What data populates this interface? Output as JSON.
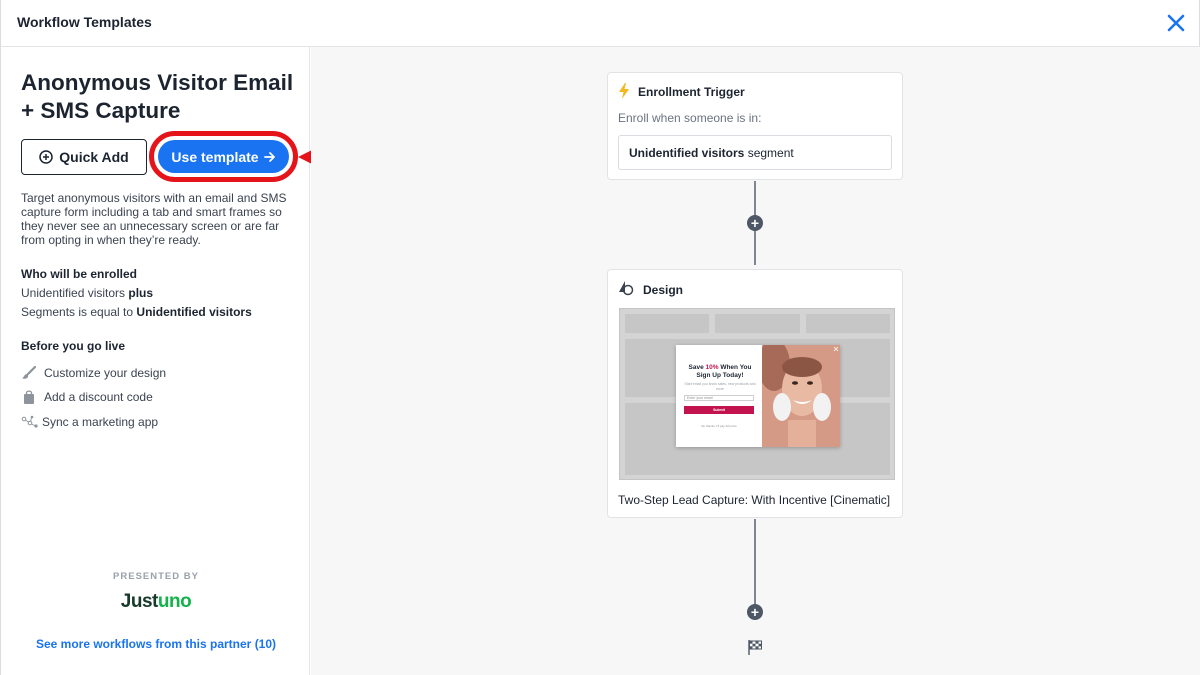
{
  "header": {
    "title": "Workflow Templates",
    "close_icon": "close-x-icon",
    "close_color": "#1a73f0"
  },
  "template": {
    "title": "Anonymous Visitor Email + SMS Capture",
    "quick_add_label": "Quick Add",
    "use_template_label": "Use template",
    "description": "Target anonymous visitors with an email and SMS capture form including a tab and smart frames so they never see an unnecessary screen or are far from opting in when they’re ready.",
    "enrolled": {
      "heading": "Who will be enrolled",
      "line1_text": "Unidentified visitors ",
      "line1_bold": "plus",
      "line2_text": "Segments is equal to ",
      "line2_bold": "Unidentified visitors"
    },
    "before_live": {
      "heading": "Before you go live",
      "items": [
        {
          "label": "Customize your design",
          "icon": "paintbrush-icon"
        },
        {
          "label": "Add a discount code",
          "icon": "shopping-bag-icon"
        },
        {
          "label": "Sync a marketing app",
          "icon": "integration-nodes-icon"
        }
      ]
    },
    "presented_by": "PRESENTED BY",
    "partner_logo_a": "Just",
    "partner_logo_b": "uno",
    "more_link": "See more workflows from this partner (10)"
  },
  "flow": {
    "trigger": {
      "title": "Enrollment Trigger",
      "subtitle": "Enroll when someone is in:",
      "segment_bold": "Unidentified visitors",
      "segment_text": " segment",
      "icon": "lightning-icon"
    },
    "design": {
      "title": "Design",
      "icon": "shapes-icon",
      "caption": "Two-Step Lead Capture: With Incentive [Cinematic]",
      "popup": {
        "headline_a": "Save ",
        "headline_accent": "10%",
        "headline_b": " When You Sign Up Today!",
        "subtext": "Start email you know sales, new products and more",
        "input_placeholder": "Enter your email",
        "submit": "Submit",
        "decline": "No thanks, I'll pay full price"
      }
    }
  },
  "colors": {
    "accent": "#1a73f0",
    "annotation_red": "#e5141a",
    "popup_accent": "#c2134f",
    "trigger_icon": "#f3b81b"
  },
  "annotation": {
    "arrow_icon": "red-arrow-annotation"
  }
}
